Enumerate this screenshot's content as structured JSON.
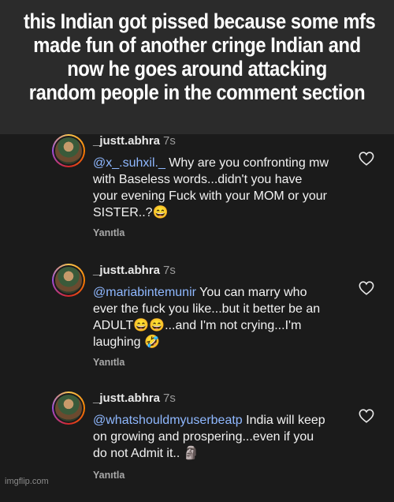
{
  "caption": {
    "line1": "this Indian got pissed because some mfs",
    "line2": "made fun of another cringe Indian and",
    "line3": "now he goes around attacking",
    "line4": "random people in the comment section"
  },
  "comments": [
    {
      "username": "_justt.abhra",
      "time": "7s",
      "mention": "@x_.suhxil._",
      "text": " Why are you confronting mw with Baseless words...didn't you have your evening Fuck with your MOM or your SISTER..?😄",
      "reply_label": "Yanıtla"
    },
    {
      "username": "_justt.abhra",
      "time": "7s",
      "mention": "@mariabintemunir",
      "text": " You can marry who ever the fuck you like...but it better be an ADULT😄😄...and I'm not crying...I'm laughing 🤣",
      "reply_label": "Yanıtla"
    },
    {
      "username": "_justt.abhra",
      "time": "7s",
      "mention": "@whatshouldmyuserbeatp",
      "text": " India will keep on growing and prospering...even if you do not Admit it.. 🗿",
      "reply_label": "Yanıtla"
    }
  ],
  "watermark": "imgflip.com",
  "colors": {
    "mention": "#8fb8ff",
    "background": "#1b1b1b",
    "caption_bg": "#2b2b2b"
  },
  "icons": {
    "heart": "heart-icon"
  }
}
